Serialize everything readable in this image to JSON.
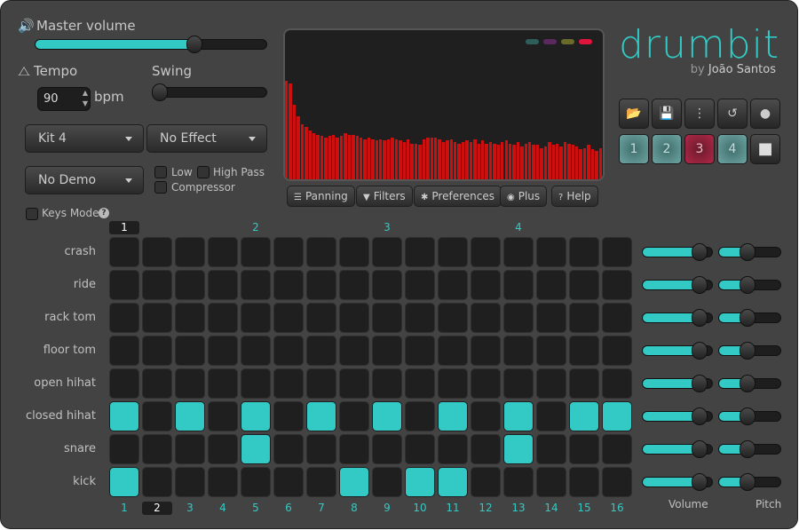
{
  "master_volume": {
    "label": "Master volume",
    "icon": "speaker-icon",
    "value": 0.7
  },
  "tempo": {
    "label": "Tempo",
    "icon": "metronome-icon",
    "value": "90",
    "unit": "bpm"
  },
  "swing": {
    "label": "Swing",
    "value": 0
  },
  "kit_select": {
    "value": "Kit 4"
  },
  "effect_select": {
    "value": "No Effect"
  },
  "demo_select": {
    "value": "No Demo"
  },
  "filters": {
    "low": "Low",
    "high_pass": "High Pass",
    "compressor": "Compressor"
  },
  "keys_mode": {
    "label": "Keys Mode",
    "checked": false
  },
  "visualizer": {
    "legend_colors": [
      "#2e5e5c",
      "#5a2a5e",
      "#6a6a2a",
      "#e0143c"
    ],
    "bar_color": "#cc1010",
    "levels": [
      0.66,
      0.64,
      0.5,
      0.42,
      0.37,
      0.35,
      0.33,
      0.31,
      0.3,
      0.29,
      0.28,
      0.29,
      0.3,
      0.28,
      0.29,
      0.31,
      0.3,
      0.3,
      0.29,
      0.28,
      0.27,
      0.28,
      0.27,
      0.26,
      0.27,
      0.26,
      0.27,
      0.28,
      0.27,
      0.26,
      0.25,
      0.27,
      0.24,
      0.24,
      0.23,
      0.27,
      0.28,
      0.28,
      0.28,
      0.27,
      0.25,
      0.26,
      0.27,
      0.25,
      0.24,
      0.25,
      0.26,
      0.25,
      0.27,
      0.24,
      0.26,
      0.24,
      0.25,
      0.24,
      0.23,
      0.25,
      0.26,
      0.24,
      0.23,
      0.25,
      0.22,
      0.24,
      0.25,
      0.23,
      0.23,
      0.21,
      0.22,
      0.25,
      0.23,
      0.24,
      0.22,
      0.25,
      0.24,
      0.23,
      0.22,
      0.2,
      0.21,
      0.23,
      0.2,
      0.19,
      0.21
    ]
  },
  "view_buttons": [
    {
      "label": "Panning",
      "icon": "sliders-icon"
    },
    {
      "label": "Filters",
      "icon": "filter-icon"
    },
    {
      "label": "Preferences",
      "icon": "gear-icon"
    },
    {
      "label": "Plus",
      "icon": "chrome-icon"
    },
    {
      "label": "Help",
      "icon": "help-icon"
    }
  ],
  "brand": {
    "title": "drumbit",
    "by": "by",
    "author": "João Santos",
    "color": "#33c9c4"
  },
  "toolbar": [
    {
      "icon": "folder-open-icon",
      "glyph": "📂"
    },
    {
      "icon": "save-icon",
      "glyph": "💾"
    },
    {
      "icon": "more-vertical-icon",
      "glyph": "⋮"
    },
    {
      "icon": "undo-icon",
      "glyph": "↺"
    },
    {
      "icon": "record-icon",
      "glyph": "●"
    }
  ],
  "patterns": [
    "1",
    "2",
    "3",
    "4"
  ],
  "active_pattern": "3",
  "stop": {
    "icon": "stop-icon",
    "glyph": "■"
  },
  "bars": [
    "1",
    "2",
    "3",
    "4"
  ],
  "current_bar": "1",
  "steps": [
    "1",
    "2",
    "3",
    "4",
    "5",
    "6",
    "7",
    "8",
    "9",
    "10",
    "11",
    "12",
    "13",
    "14",
    "15",
    "16"
  ],
  "current_step": "2",
  "tracks": [
    {
      "name": "crash",
      "steps": [],
      "volume": 0.9,
      "pitch": 0.45
    },
    {
      "name": "ride",
      "steps": [],
      "volume": 0.9,
      "pitch": 0.45
    },
    {
      "name": "rack tom",
      "steps": [],
      "volume": 0.9,
      "pitch": 0.45
    },
    {
      "name": "floor tom",
      "steps": [],
      "volume": 0.9,
      "pitch": 0.45
    },
    {
      "name": "open hihat",
      "steps": [],
      "volume": 0.9,
      "pitch": 0.45
    },
    {
      "name": "closed hihat",
      "steps": [
        1,
        3,
        5,
        7,
        9,
        11,
        13,
        15,
        16
      ],
      "volume": 0.9,
      "pitch": 0.45
    },
    {
      "name": "snare",
      "steps": [
        5,
        13
      ],
      "volume": 0.9,
      "pitch": 0.45
    },
    {
      "name": "kick",
      "steps": [
        1,
        8,
        10,
        11
      ],
      "volume": 0.9,
      "pitch": 0.45
    }
  ],
  "column_labels": {
    "volume": "Volume",
    "pitch": "Pitch"
  }
}
